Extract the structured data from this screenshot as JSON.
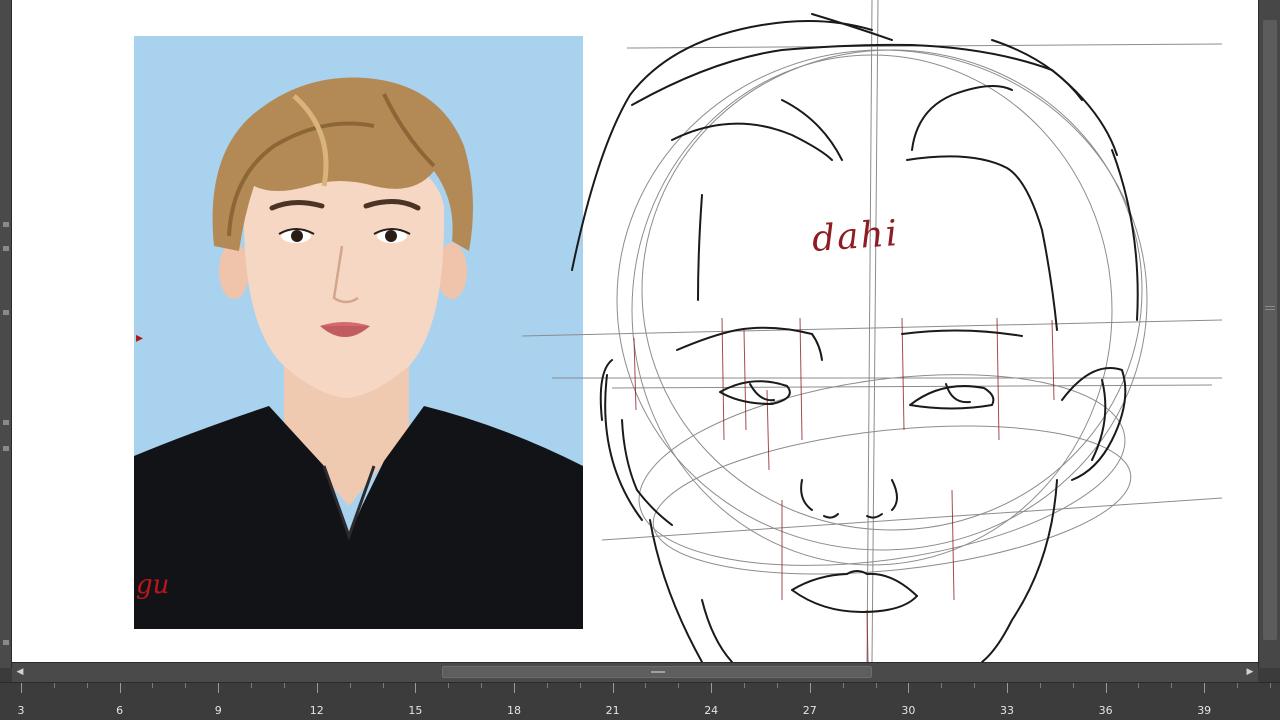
{
  "canvas": {
    "annotations": {
      "dahi": "dahi",
      "signature": "gu"
    },
    "reference_photo": {
      "alt": "portrait reference photo"
    },
    "sketch_colors": {
      "line": "#1a1a1a",
      "construction": "#8c8c8c",
      "guide": "#8e1c22"
    }
  },
  "ruler": {
    "labels": [
      "3",
      "6",
      "9",
      "12",
      "15",
      "18",
      "21",
      "24",
      "27",
      "30",
      "33",
      "36",
      "39"
    ]
  },
  "scrollbars": {
    "left_arrow": "◀",
    "right_arrow": "▶"
  }
}
